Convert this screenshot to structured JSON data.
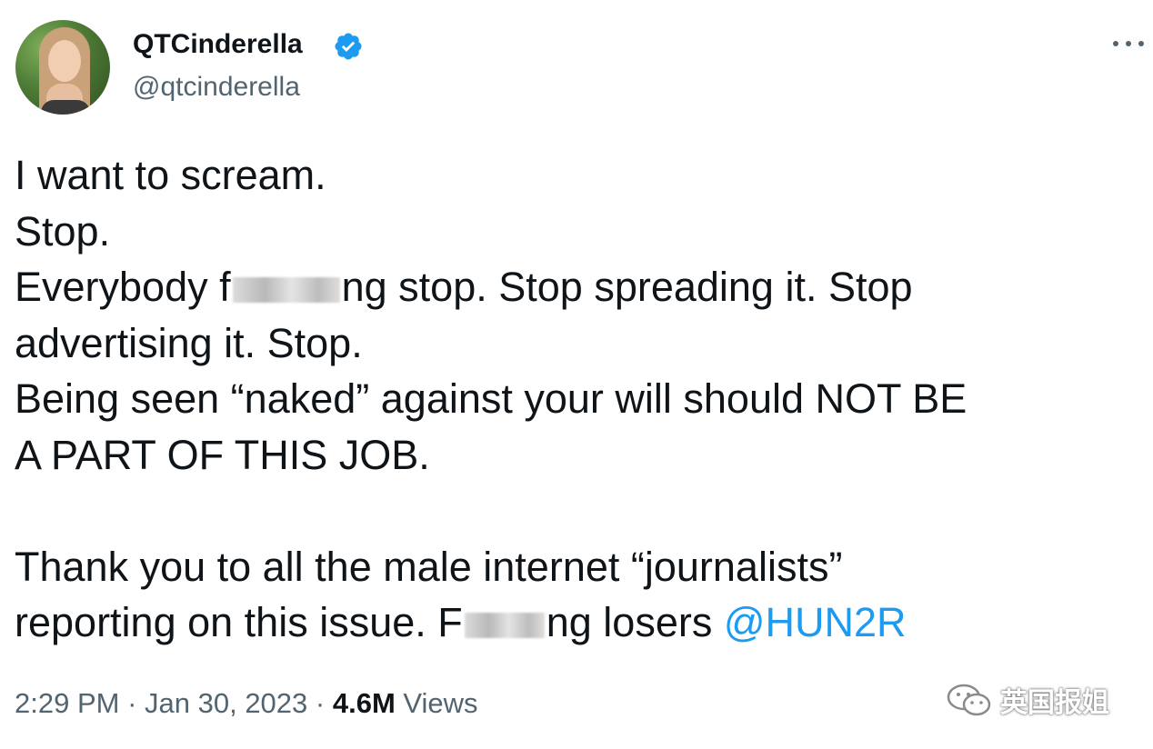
{
  "user": {
    "display_name": "QTCinderella",
    "handle": "@qtcinderella",
    "avatar_icon": "avatar",
    "verified_icon": "verified-badge-icon",
    "verified_color": "#1d9bf0"
  },
  "tweet": {
    "line1": "I want to scream.",
    "line2": "Stop.",
    "line3_a": "Everybody f",
    "line3_b": "ng stop. Stop spreading it. Stop",
    "line4": "advertising it. Stop.",
    "line5": "Being seen “naked” against your will should NOT BE",
    "line6": "A PART OF THIS JOB.",
    "line8": "Thank you to all the male internet “journalists”",
    "line9_a": "reporting on this issue. F",
    "line9_b": "ng losers ",
    "mention": "@HUN2R"
  },
  "meta": {
    "time": "2:29 PM",
    "sep1": " · ",
    "date": "Jan 30, 2023",
    "sep2": " · ",
    "views_count": "4.6M",
    "views_label": " Views"
  },
  "more_icon": "more-horizontal-icon",
  "watermark": {
    "text": "英国报姐",
    "icon": "wechat-icon"
  },
  "colors": {
    "text": "#0f1419",
    "secondary": "#536471",
    "link": "#1d9bf0"
  }
}
